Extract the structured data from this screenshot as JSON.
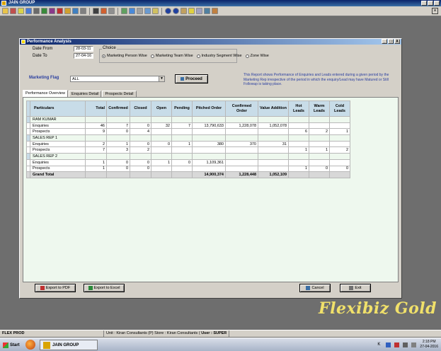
{
  "app": {
    "title": "JAIN GROUP"
  },
  "window": {
    "title": "Performance Analysis",
    "controls": [
      "_",
      "□",
      "X"
    ]
  },
  "filters": {
    "date_from_label": "Date From",
    "date_from_value": "28-03-11",
    "date_to_label": "Date To",
    "date_to_value": "27-04-16",
    "choice_label": "Choice",
    "choices": [
      {
        "label": "Marketing Person Wise",
        "selected": true
      },
      {
        "label": "Marketing Team Wise",
        "selected": false
      },
      {
        "label": "Industry Segment Wise",
        "selected": false
      },
      {
        "label": "Zone Wise",
        "selected": false
      }
    ],
    "marketing_flag_label": "Marketing Flag",
    "marketing_flag_value": "ALL",
    "proceed_label": "Proceed",
    "info_text": "This Report shows Performance of Enquiries and Leads entered during a given period by the Marketing Rep irrespective of the period in which the enquiry/Lead may have Matured or Still Followup is taking place."
  },
  "tabs": [
    "Performance Overview",
    "Enquiries Detail",
    "Prospects Detail"
  ],
  "active_tab": 0,
  "grid": {
    "columns": [
      "Particulars",
      "Total",
      "Confirmed",
      "Closed",
      "Open",
      "Pending",
      "Pitched Order",
      "Confirmed Order",
      "Value Addition",
      "Hot Leads",
      "Warm Leads",
      "Cold Leads"
    ],
    "rows": [
      {
        "type": "group",
        "selected": true,
        "cells": [
          "RAM KUMAR",
          "",
          "",
          "",
          "",
          "",
          "",
          "",
          "",
          "",
          "",
          ""
        ]
      },
      {
        "type": "data",
        "cells": [
          "Enquiries",
          "46",
          "7",
          "0",
          "32",
          "7",
          "13,790,633",
          "1,228,078",
          "1,052,078",
          "",
          "",
          ""
        ]
      },
      {
        "type": "data",
        "cells": [
          "Prospects",
          "9",
          "0",
          "4",
          "",
          "",
          "",
          "",
          "",
          "6",
          "2",
          "1"
        ]
      },
      {
        "type": "group",
        "selected": false,
        "cells": [
          "SALES REP 1",
          "",
          "",
          "",
          "",
          "",
          "",
          "",
          "",
          "",
          "",
          ""
        ]
      },
      {
        "type": "data",
        "cells": [
          "Enquiries",
          "2",
          "1",
          "0",
          "0",
          "1",
          "380",
          "370",
          "31",
          "",
          "",
          ""
        ]
      },
      {
        "type": "data",
        "cells": [
          "Prospects",
          "7",
          "3",
          "2",
          "",
          "",
          "",
          "",
          "",
          "1",
          "1",
          "2"
        ]
      },
      {
        "type": "group",
        "selected": false,
        "cells": [
          "SALES REP 2",
          "",
          "",
          "",
          "",
          "",
          "",
          "",
          "",
          "",
          "",
          ""
        ]
      },
      {
        "type": "data",
        "cells": [
          "Enquiries",
          "1",
          "0",
          "0",
          "1",
          "0",
          "1,109,361",
          "",
          "",
          "",
          "",
          ""
        ]
      },
      {
        "type": "data",
        "cells": [
          "Prospects",
          "1",
          "0",
          "0",
          "",
          "",
          "",
          "",
          "",
          "1",
          "0",
          "0"
        ]
      },
      {
        "type": "total",
        "cells": [
          "Grand Total",
          "",
          "",
          "",
          "",
          "",
          "14,900,374",
          "1,228,448",
          "1,052,109",
          "",
          "",
          ""
        ]
      }
    ]
  },
  "buttons": {
    "export_pdf": "Export to PDF",
    "export_excel": "Export to Excel",
    "cancel": "Cancel",
    "exit": "Exit"
  },
  "brand": "Flexibiz Gold",
  "statusbar": {
    "left": "FLEX PROD",
    "middle": "Unit : Kiran Consultants (P) Store : Kiran Consultants (",
    "user": "User : SUPER"
  },
  "taskbar": {
    "start": "Start",
    "app": "JAIN GROUP",
    "time": "2:18 PM",
    "date": "27-04-2016"
  },
  "colors": {
    "title_bar": "#0a246a",
    "group_row": "#f4c8d4",
    "grid_header": "#c8dce8",
    "panel_bg": "#eef8ee",
    "brand": "#f0e06a"
  }
}
